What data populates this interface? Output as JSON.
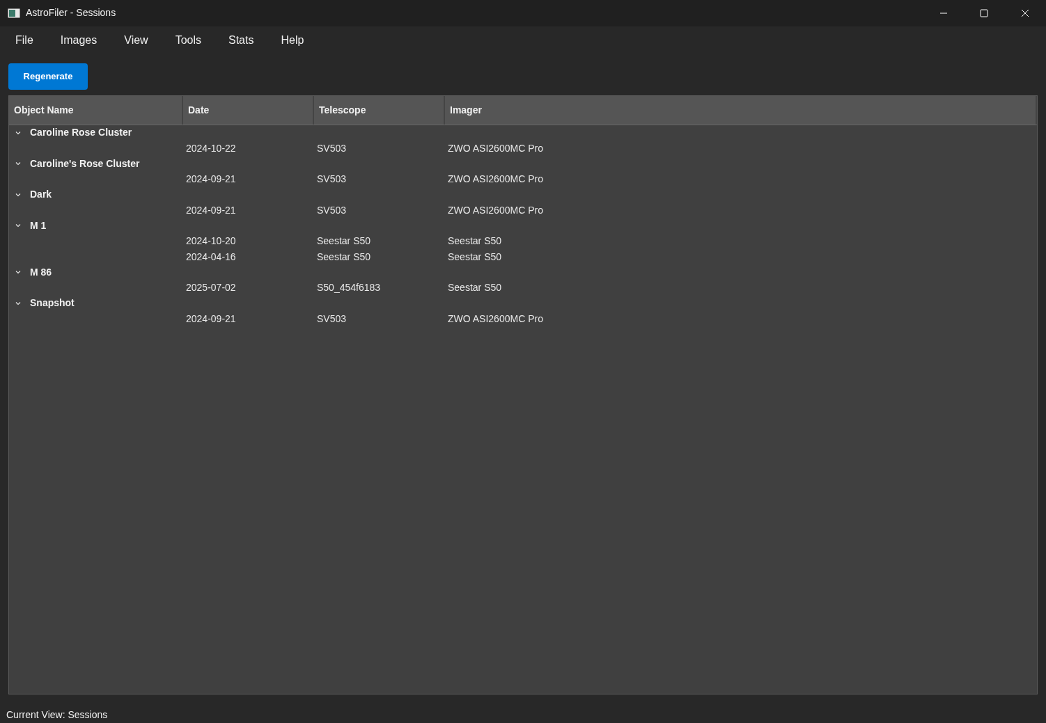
{
  "window": {
    "title": "AstroFiler - Sessions"
  },
  "menu": [
    "File",
    "Images",
    "View",
    "Tools",
    "Stats",
    "Help"
  ],
  "toolbar": {
    "button": "Regenerate"
  },
  "table": {
    "columns": [
      "Object Name",
      "Date",
      "Telescope",
      "Imager"
    ],
    "groups": [
      {
        "name": "Caroline Rose Cluster",
        "expanded": true,
        "children": [
          {
            "date": "2024-10-22",
            "telescope": "SV503",
            "imager": "ZWO ASI2600MC Pro"
          }
        ]
      },
      {
        "name": "Caroline's Rose Cluster",
        "expanded": true,
        "children": [
          {
            "date": "2024-09-21",
            "telescope": "SV503",
            "imager": "ZWO ASI2600MC Pro"
          }
        ]
      },
      {
        "name": "Dark",
        "expanded": true,
        "children": [
          {
            "date": "2024-09-21",
            "telescope": "SV503",
            "imager": "ZWO ASI2600MC Pro"
          }
        ]
      },
      {
        "name": "M 1",
        "expanded": true,
        "children": [
          {
            "date": "2024-10-20",
            "telescope": "Seestar S50",
            "imager": "Seestar S50"
          },
          {
            "date": "2024-04-16",
            "telescope": "Seestar S50",
            "imager": "Seestar S50"
          }
        ]
      },
      {
        "name": "M 86",
        "expanded": true,
        "children": [
          {
            "date": "2025-07-02",
            "telescope": "S50_454f6183",
            "imager": "Seestar S50"
          }
        ]
      },
      {
        "name": "Snapshot",
        "expanded": true,
        "children": [
          {
            "date": "2024-09-21",
            "telescope": "SV503",
            "imager": "ZWO ASI2600MC Pro"
          }
        ]
      }
    ]
  },
  "status_bar": "Current View: Sessions"
}
